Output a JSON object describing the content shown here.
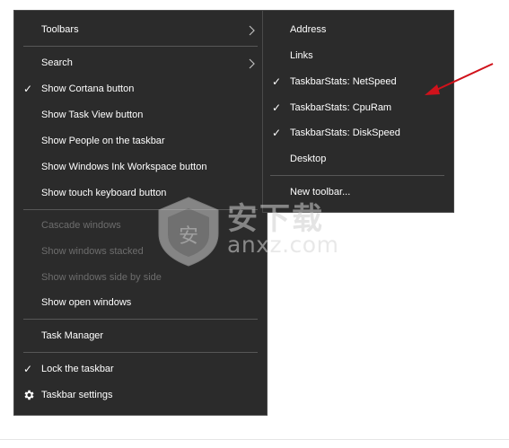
{
  "main_menu": {
    "items": [
      {
        "label": "Toolbars",
        "checked": false,
        "disabled": false,
        "submenu": true,
        "icon": null
      },
      {
        "label": "Search",
        "checked": false,
        "disabled": false,
        "submenu": true,
        "icon": null
      },
      {
        "label": "Show Cortana button",
        "checked": true,
        "disabled": false,
        "submenu": false,
        "icon": null
      },
      {
        "label": "Show Task View button",
        "checked": false,
        "disabled": false,
        "submenu": false,
        "icon": null
      },
      {
        "label": "Show People on the taskbar",
        "checked": false,
        "disabled": false,
        "submenu": false,
        "icon": null
      },
      {
        "label": "Show Windows Ink Workspace button",
        "checked": false,
        "disabled": false,
        "submenu": false,
        "icon": null
      },
      {
        "label": "Show touch keyboard button",
        "checked": false,
        "disabled": false,
        "submenu": false,
        "icon": null
      },
      {
        "label": "Cascade windows",
        "checked": false,
        "disabled": true,
        "submenu": false,
        "icon": null
      },
      {
        "label": "Show windows stacked",
        "checked": false,
        "disabled": true,
        "submenu": false,
        "icon": null
      },
      {
        "label": "Show windows side by side",
        "checked": false,
        "disabled": true,
        "submenu": false,
        "icon": null
      },
      {
        "label": "Show open windows",
        "checked": false,
        "disabled": false,
        "submenu": false,
        "icon": null
      },
      {
        "label": "Task Manager",
        "checked": false,
        "disabled": false,
        "submenu": false,
        "icon": null
      },
      {
        "label": "Lock the taskbar",
        "checked": true,
        "disabled": false,
        "submenu": false,
        "icon": null
      },
      {
        "label": "Taskbar settings",
        "checked": false,
        "disabled": false,
        "submenu": false,
        "icon": "gear-icon"
      }
    ]
  },
  "sub_menu": {
    "items": [
      {
        "label": "Address",
        "checked": false
      },
      {
        "label": "Links",
        "checked": false
      },
      {
        "label": "TaskbarStats: NetSpeed",
        "checked": true
      },
      {
        "label": "TaskbarStats: CpuRam",
        "checked": true
      },
      {
        "label": "TaskbarStats: DiskSpeed",
        "checked": true
      },
      {
        "label": "Desktop",
        "checked": false
      },
      {
        "label": "New toolbar...",
        "checked": false
      }
    ]
  },
  "check_glyph": "✓",
  "colors": {
    "menu_bg": "#2b2b2b",
    "text": "#ffffff",
    "disabled_text": "#6d6d6d",
    "separator": "#575757",
    "annotation_arrow": "#d0121b"
  },
  "watermark": {
    "text_cn": "安下载",
    "text_en": "anxz.com",
    "badge": "安"
  }
}
